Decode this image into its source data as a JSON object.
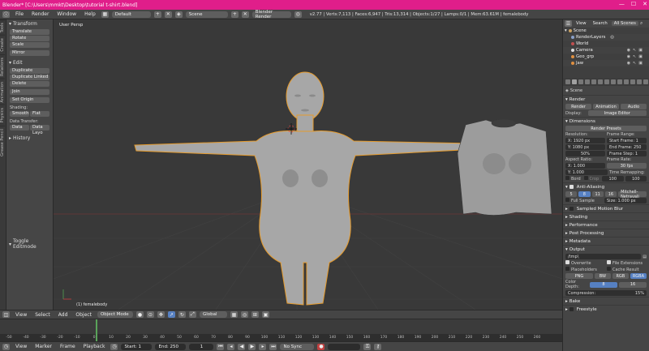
{
  "titlebar": {
    "title": "Blender* [C:\\Users\\mmkt\\Desktop\\tutorial t-shirt.blend]",
    "min": "—",
    "max": "☐",
    "close": "✕"
  },
  "topbar": {
    "menus": [
      "File",
      "Render",
      "Window",
      "Help"
    ],
    "screen_layout": "Default",
    "scene": "Scene",
    "engine": "Blender Render",
    "stats": "v2.77 | Verts:7,113 | Faces:6,947 | Tris:13,314 | Objects:1/27 | Lamps:0/1 | Mem:63.61M | femalebody"
  },
  "tool_tabs": [
    "Tools",
    "Create",
    "Relations",
    "Animation",
    "Physics",
    "Grease Pencil"
  ],
  "toolshelf": {
    "transform": {
      "header": "Transform",
      "buttons": [
        "Translate",
        "Rotate",
        "Scale",
        "Mirror"
      ]
    },
    "edit": {
      "header": "Edit",
      "buttons": [
        "Duplicate",
        "Duplicate Linked",
        "Delete",
        "Join"
      ],
      "set_origin": "Set Origin"
    },
    "shading": {
      "label": "Shading:",
      "smooth": "Smooth",
      "flat": "Flat"
    },
    "data_transfer": {
      "label": "Data Transfer:",
      "data": "Data",
      "data_layo": "Data Layo"
    },
    "history": "History",
    "toggle_editmode": "Toggle Editmode"
  },
  "viewport": {
    "label": "User Persp",
    "object_label": "(1) femalebody"
  },
  "outliner": {
    "tabs": [
      "View",
      "Search",
      "All Scenes"
    ],
    "rows": [
      {
        "label": "Scene",
        "color": "#c9a060"
      },
      {
        "label": "RenderLayers",
        "color": "#8aa0c9"
      },
      {
        "label": "World",
        "color": "#c05050"
      },
      {
        "label": "Camera",
        "color": "#e0e0e0"
      },
      {
        "label": "Geo_grp",
        "color": "#e09040"
      },
      {
        "label": "Jaw",
        "color": "#e09040"
      }
    ]
  },
  "properties": {
    "scene_name": "Scene",
    "render": {
      "header": "Render",
      "render_btn": "Render",
      "animation_btn": "Animation",
      "audio_btn": "Audio",
      "display_label": "Display:",
      "display_value": "Image Editor"
    },
    "dimensions": {
      "header": "Dimensions",
      "presets": "Render Presets",
      "resolution_label": "Resolution:",
      "frame_range_label": "Frame Range:",
      "res_x": "X: 1920 px",
      "res_y": "Y: 1080 px",
      "res_pct": "50%",
      "start": "Start Frame: 1",
      "end": "End Frame: 250",
      "step": "Frame Step: 1",
      "aspect_label": "Aspect Ratio:",
      "frame_rate_label": "Frame Rate:",
      "asp_x": "X: 1.000",
      "asp_y": "Y: 1.000",
      "fps": "30 fps",
      "time_remap": "Time Remapping:",
      "old": "100",
      "new": "100",
      "border": "Bord",
      "crop": "Crop"
    },
    "anti_aliasing": {
      "header": "Anti-Aliasing",
      "samples": [
        "5",
        "8",
        "11",
        "16"
      ],
      "filter": "Mitchell-Netravali",
      "full_sample": "Full Sample",
      "size": "Size: 1.000 px"
    },
    "sections": [
      "Sampled Motion Blur",
      "Shading",
      "Performance",
      "Post Processing",
      "Metadata"
    ],
    "output": {
      "header": "Output",
      "path": "/tmp\\",
      "overwrite": "Overwrite",
      "file_extensions": "File Extensions",
      "placeholders": "Placeholders",
      "cache_result": "Cache Result",
      "format": "PNG",
      "bw": "BW",
      "rgb": "RGB",
      "rgba": "RGBA",
      "color_depth_label": "Color Depth:",
      "depth_8": "8",
      "depth_16": "16",
      "compression": "Compression:",
      "compression_val": "15%"
    },
    "bake": "Bake",
    "freestyle": "Freestyle"
  },
  "viewport_header": {
    "view": "View",
    "select": "Select",
    "add": "Add",
    "object": "Object",
    "mode": "Object Mode",
    "orientation": "Global"
  },
  "timeline": {
    "ticks": [
      "-50",
      "-40",
      "-30",
      "-20",
      "-10",
      "0",
      "10",
      "20",
      "30",
      "40",
      "50",
      "60",
      "70",
      "80",
      "90",
      "100",
      "110",
      "120",
      "130",
      "140",
      "150",
      "160",
      "170",
      "180",
      "190",
      "200",
      "210",
      "220",
      "230",
      "240",
      "250",
      "260"
    ],
    "current_frame": "1",
    "view": "View",
    "marker": "Marker",
    "frame": "Frame",
    "playback": "Playback",
    "start": "Start: 1",
    "end": "End: 250",
    "cur": "1",
    "sync": "No Sync"
  }
}
